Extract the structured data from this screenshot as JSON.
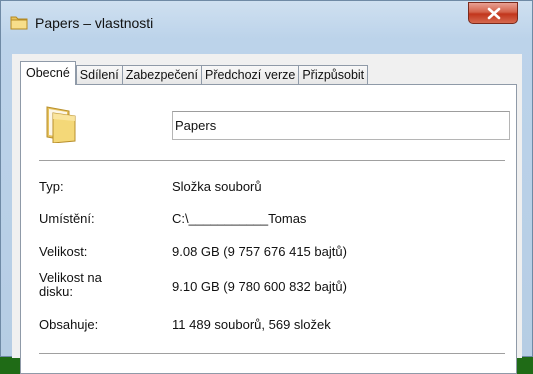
{
  "window": {
    "title": "Papers – vlastnosti"
  },
  "tabs": [
    {
      "label": "Obecné",
      "active": true
    },
    {
      "label": "Sdílení",
      "active": false
    },
    {
      "label": "Zabezpečení",
      "active": false
    },
    {
      "label": "Předchozí verze",
      "active": false
    },
    {
      "label": "Přizpůsobit",
      "active": false
    }
  ],
  "general": {
    "folder_name": "Papers",
    "rows": [
      {
        "label": "Typ:",
        "value": "Složka souborů"
      },
      {
        "label": "Umístění:",
        "value": "C:\\___________Tomas"
      },
      {
        "label": "Velikost:",
        "value": "9.08 GB (9 757 676 415 bajtů)"
      },
      {
        "label": "Velikost na disku:",
        "value": "9.10 GB (9 780 600 832 bajtů)"
      },
      {
        "label": "Obsahuje:",
        "value": "11 489 souborů, 569 složek"
      }
    ]
  },
  "icons": {
    "title": "folder-icon",
    "main": "folder-icon",
    "close": "close-icon"
  },
  "colors": {
    "desktop": "#1f6b16",
    "close_button": "#c2351c",
    "folder": "#f2d77b"
  }
}
